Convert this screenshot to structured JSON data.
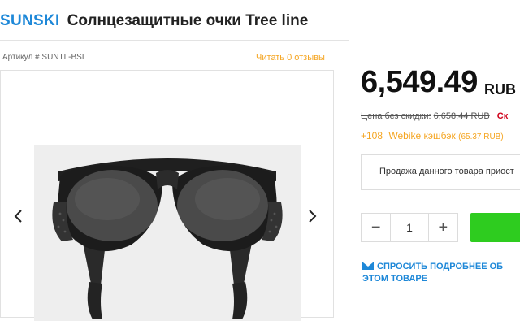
{
  "header": {
    "brand": "SUNSKI",
    "title": "Солнцезащитные очки Tree line"
  },
  "meta": {
    "sku": "Артикул # SUNTL-BSL",
    "reviews_link": "Читать 0 отзывы"
  },
  "gallery": {
    "prev_icon": "chevron-left-icon",
    "next_icon": "chevron-right-icon",
    "image": "black-glacier-sunglasses"
  },
  "pricing": {
    "price": "6,549.49",
    "currency": "RUB",
    "old_price_label": "Цена без скидки:",
    "old_price": "6,658.44 RUB",
    "discount_label": "Ск",
    "cashback_points": "+108",
    "cashback_text": "Webike кэшбэк",
    "cashback_amount": "(65.37 RUB)"
  },
  "availability": {
    "notice": "Продажа данного товара приост"
  },
  "purchase": {
    "minus": "−",
    "quantity": "1",
    "plus": "+"
  },
  "inquiry": {
    "link": "СПРОСИТЬ ПОДРОБНЕЕ ОБ ЭТОМ ТОВАРЕ",
    "icon": "envelope-icon"
  },
  "colors": {
    "brand": "#1e88d8",
    "accent": "#f5a623",
    "sale": "#d0021b",
    "cart": "#2ecc1f"
  }
}
